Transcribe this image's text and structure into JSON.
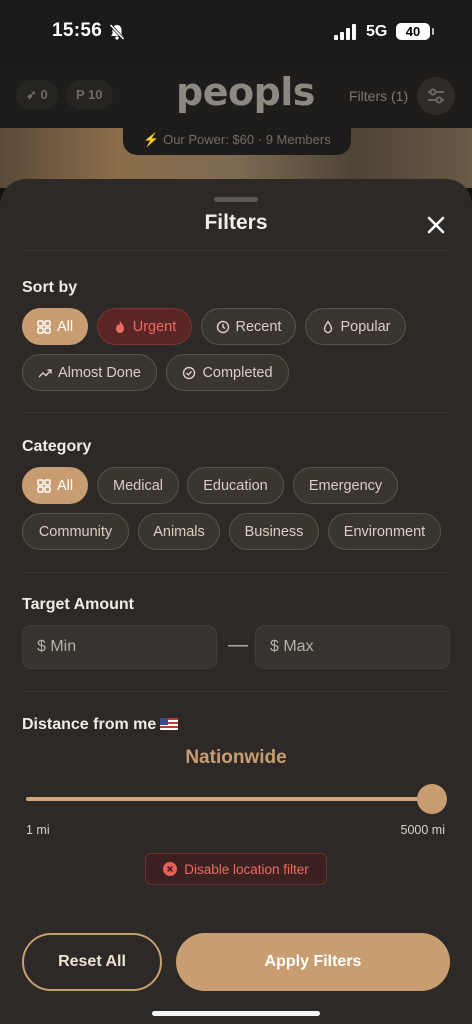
{
  "status_bar": {
    "time": "15:56",
    "network": "5G",
    "battery": "40"
  },
  "app_header": {
    "rocket_count": "0",
    "points": "P 10",
    "logo": "peopls",
    "filters_label": "Filters (1)",
    "power_text": "Our Power: $60",
    "members_text": "9 Members"
  },
  "sheet": {
    "title": "Filters",
    "sort": {
      "label": "Sort by",
      "options": [
        {
          "label": "All",
          "icon": "grid-icon",
          "selected": true
        },
        {
          "label": "Urgent",
          "icon": "flame-icon",
          "selected": false
        },
        {
          "label": "Recent",
          "icon": "clock-icon",
          "selected": false
        },
        {
          "label": "Popular",
          "icon": "drop-icon",
          "selected": false
        },
        {
          "label": "Almost Done",
          "icon": "trending-up-icon",
          "selected": false
        },
        {
          "label": "Completed",
          "icon": "check-circle-icon",
          "selected": false
        }
      ]
    },
    "category": {
      "label": "Category",
      "options": [
        {
          "label": "All",
          "selected": true
        },
        {
          "label": "Medical",
          "selected": false
        },
        {
          "label": "Education",
          "selected": false
        },
        {
          "label": "Emergency",
          "selected": false
        },
        {
          "label": "Community",
          "selected": false
        },
        {
          "label": "Animals",
          "selected": false
        },
        {
          "label": "Business",
          "selected": false
        },
        {
          "label": "Environment",
          "selected": false
        }
      ]
    },
    "target_amount": {
      "label": "Target Amount",
      "min_placeholder": "$ Min",
      "max_placeholder": "$ Max",
      "separator": "—"
    },
    "distance": {
      "label": "Distance from me",
      "value_text": "Nationwide",
      "min_label": "1 mi",
      "max_label": "5000 mi",
      "slider_value": 1.0,
      "disable_label": "Disable location filter"
    },
    "reset_label": "Reset All",
    "apply_label": "Apply Filters"
  },
  "colors": {
    "accent": "#c99d72",
    "sheet_bg": "#2c2926",
    "urgent": "#ee6a62"
  }
}
